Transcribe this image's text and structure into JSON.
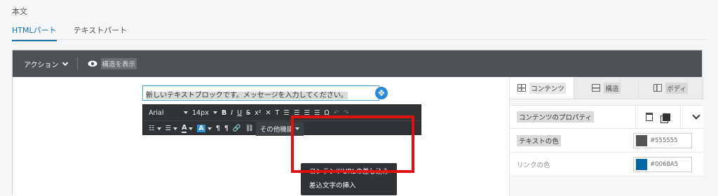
{
  "section_label": "本文",
  "tabs": [
    {
      "label": "HTMLパート",
      "active": true
    },
    {
      "label": "テキストパート",
      "active": false
    }
  ],
  "topbar": {
    "action_label": "アクション",
    "show_structure_label": "構造を表示"
  },
  "text_block": {
    "content": "新しいテキストブロックです。メッセージを入力してください。"
  },
  "rte": {
    "font_name": "Arial",
    "font_size": "14px",
    "bold": "B",
    "italic": "I",
    "underline": "U",
    "strike": "S",
    "superscript": "x²",
    "more_menu": "その他機能"
  },
  "more_dropdown": {
    "items": [
      "コンテンツURLの差し込み",
      "差込文字の挿入"
    ]
  },
  "right_panel": {
    "tabs": [
      {
        "label": "コンテンツ",
        "icon": "grid-icon",
        "active": true
      },
      {
        "label": "構造",
        "icon": "rows-icon",
        "active": false
      },
      {
        "label": "ボディ",
        "icon": "body-icon",
        "active": false
      }
    ],
    "properties_title": "コンテンツのプロパティ",
    "properties": [
      {
        "label": "テキストの色",
        "value": "#555555",
        "color": "#555555"
      },
      {
        "label": "リンクの色",
        "value": "#0068A5",
        "color": "#0068A5"
      }
    ]
  },
  "colors": {
    "accent": "#1a6fb0",
    "highlight_box": "#e01010",
    "toolbar": "#2f3336"
  }
}
